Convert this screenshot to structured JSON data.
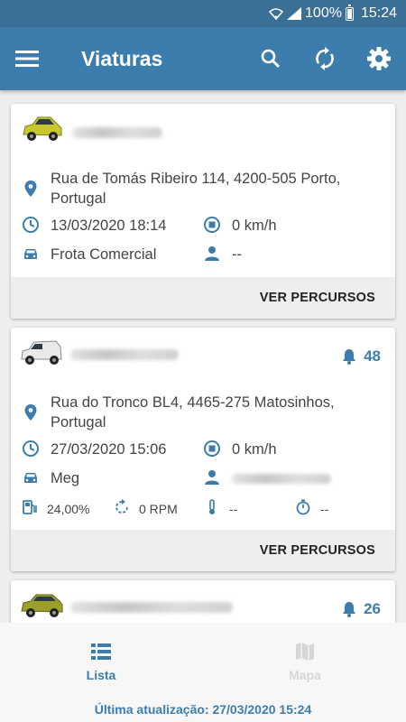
{
  "status": {
    "battery": "100%",
    "time": "15:24"
  },
  "app": {
    "title": "Viaturas"
  },
  "vehicles": [
    {
      "address": "Rua de Tomás Ribeiro 114, 4200-505 Porto, Portugal",
      "datetime": "13/03/2020 18:14",
      "speed": "0 km/h",
      "group": "Frota Comercial",
      "driver": "--",
      "button": "VER PERCURSOS",
      "car_color": "#c7c82e"
    },
    {
      "alerts": "48",
      "address": "Rua do Tronco BL4, 4465-275 Matosinhos, Portugal",
      "datetime": "27/03/2020 15:06",
      "speed": "0 km/h",
      "group": "Meg",
      "fuel": "24,00%",
      "rpm": "0 RPM",
      "temp": "--",
      "timer": "--",
      "button": "VER PERCURSOS",
      "car_color": "#e9e9e9"
    },
    {
      "alerts": "26",
      "car_color": "#9aa02a"
    }
  ],
  "nav": {
    "list_label": "Lista",
    "map_label": "Mapa"
  },
  "footer": {
    "label": "Última atualização:",
    "value": "27/03/2020 15:24"
  },
  "colors": {
    "primary": "#3d7dad",
    "status_bar": "#3a6f96",
    "inactive": "#d6d6d6"
  }
}
